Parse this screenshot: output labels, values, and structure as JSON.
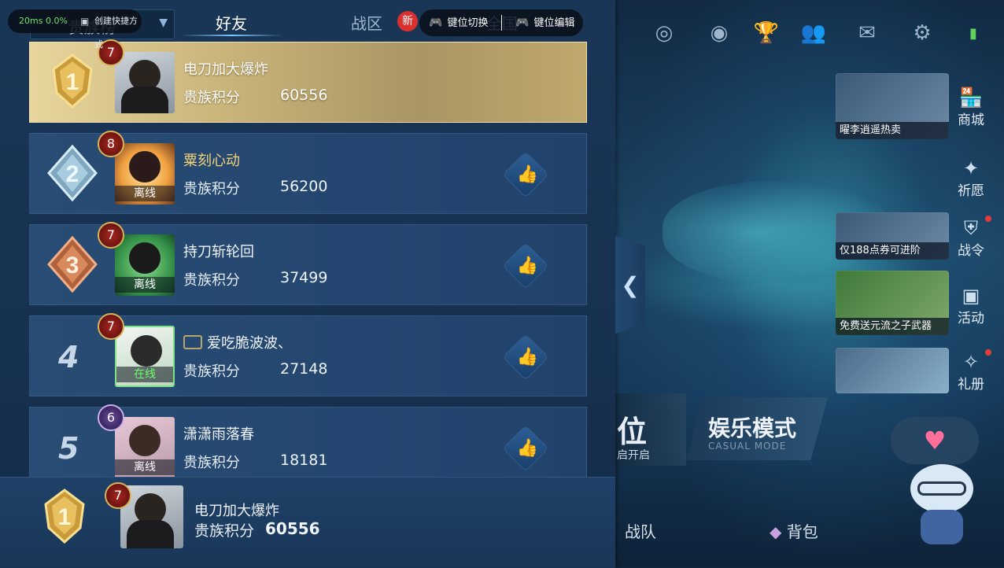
{
  "tabs": {
    "dropdown_label": "贵族榜",
    "friends": "好友",
    "region": "战区",
    "new_badge": "新",
    "global": "全国"
  },
  "overlay": {
    "ping": "20ms",
    "loss": "0.0%",
    "shortcut_label": "创建快捷方式",
    "key_switch": "键位切换",
    "key_edit": "键位编辑"
  },
  "rankings": [
    {
      "rank": "1",
      "level": "7",
      "name": "电刀加大爆炸",
      "score_label": "贵族积分",
      "score": "60556",
      "status": "",
      "highlight": true
    },
    {
      "rank": "2",
      "level": "8",
      "name": "粟刻心动",
      "score_label": "贵族积分",
      "score": "56200",
      "status": "离线"
    },
    {
      "rank": "3",
      "level": "7",
      "name": "持刀斩轮回",
      "score_label": "贵族积分",
      "score": "37499",
      "status": "离线"
    },
    {
      "rank": "4",
      "level": "7",
      "name": "爱吃脆波波、",
      "score_label": "贵族积分",
      "score": "27148",
      "status": "在线"
    },
    {
      "rank": "5",
      "level": "6",
      "name": "潇潇雨落春",
      "score_label": "贵族积分",
      "score": "18181",
      "status": "离线"
    }
  ],
  "me": {
    "rank": "1",
    "level": "7",
    "name": "电刀加大爆炸",
    "score_label": "贵族积分",
    "score": "60556"
  },
  "side": {
    "shop_caption": "曜李逍遥热卖",
    "shop_label": "商城",
    "wish_label": "祈愿",
    "pass_caption": "仅188点券可进阶",
    "pass_label": "战令",
    "event_caption": "免费送元流之子武器",
    "event_label": "活动",
    "book_label": "礼册"
  },
  "modes": {
    "rank_big": "位",
    "rank_small": "启开启",
    "fun_big": "娱乐模式",
    "fun_small": "CASUAL MODE"
  },
  "bottom": {
    "team": "战队",
    "bag": "背包"
  },
  "colors": {
    "gold_row": "#c9b47a",
    "panel": "#1a3656",
    "accent": "#7fc6ff"
  }
}
